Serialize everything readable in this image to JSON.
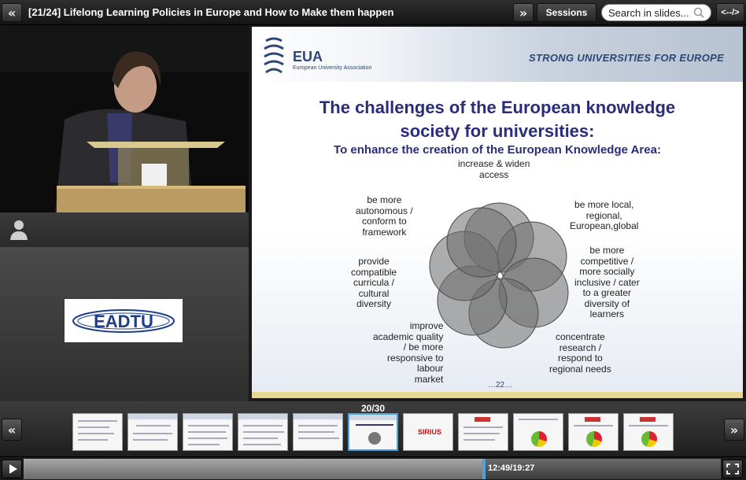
{
  "topbar": {
    "prev_symbol": "«",
    "title": "[21/24] Lifelong Learning Policies in Europe and How to Make them happen",
    "next_symbol": "»",
    "sessions_label": "Sessions",
    "search_placeholder": "Search in slides...",
    "embed_label": "<--/>"
  },
  "left_panel": {
    "speaker_icon": "person-silhouette-icon",
    "logo_text": "EADTU"
  },
  "slide": {
    "logo_text": "EUA",
    "logo_subtitle": "European University Association",
    "tagline": "STRONG UNIVERSITIES FOR EUROPE",
    "title": "The challenges of the European knowledge\nsociety for universities:",
    "subtitle": "To enhance the creation of the European Knowledge Area:",
    "labels": [
      "increase & widen\naccess",
      "be more local,\nregional,\nEuropean,global",
      "be more\ncompetitive /\nmore socially\ninclusive / cater\nto       a greater\ndiversity of\nlearners",
      "concentrate\nresearch /\nrespond to\nregional needs",
      "improve\nacademic quality\n/ be more\nresponsive to\nlabour\nmarket",
      "provide\ncompatible\ncurricula /\ncultural\ndiversity",
      "be more\nautonomous /\nconform to\nframework"
    ],
    "slide_number": "22"
  },
  "thumbnails": {
    "counter": "20/30",
    "prev_symbol": "«",
    "next_symbol": "»"
  },
  "player": {
    "time": "12:49/19:27",
    "progress_fraction": 0.66
  }
}
